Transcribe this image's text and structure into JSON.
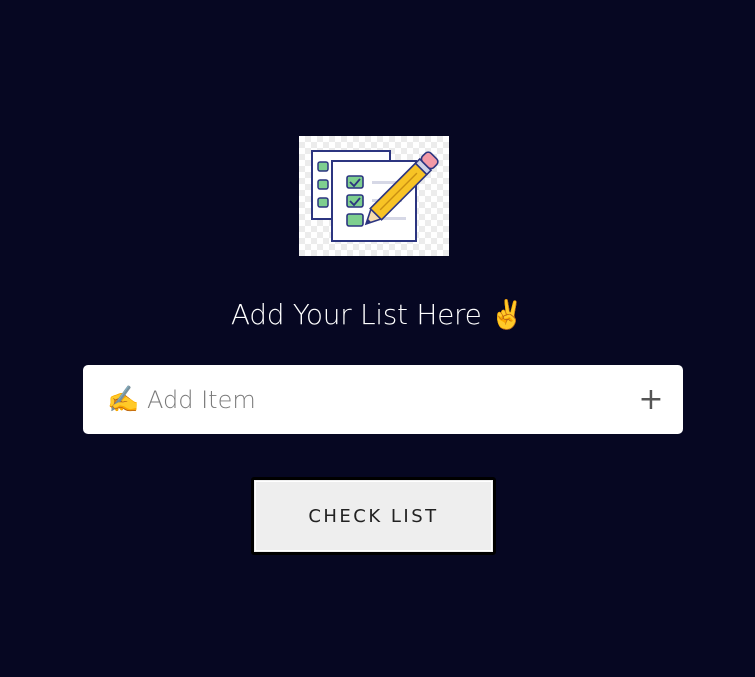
{
  "logo": {
    "icon": "checklist-pencil-icon"
  },
  "heading": {
    "text": "Add Your List Here",
    "emoji": "✌️"
  },
  "add_item": {
    "emoji": "✍️",
    "placeholder": "Add Item",
    "value": "",
    "add_symbol": "+"
  },
  "check_button": {
    "label": "CHECK LIST"
  },
  "colors": {
    "background": "#060722",
    "input_background": "#ffffff",
    "button_background": "#eeeeee",
    "pencil": "#f7c325",
    "check_box": "#7ecf8f",
    "outline": "#2c3580"
  }
}
